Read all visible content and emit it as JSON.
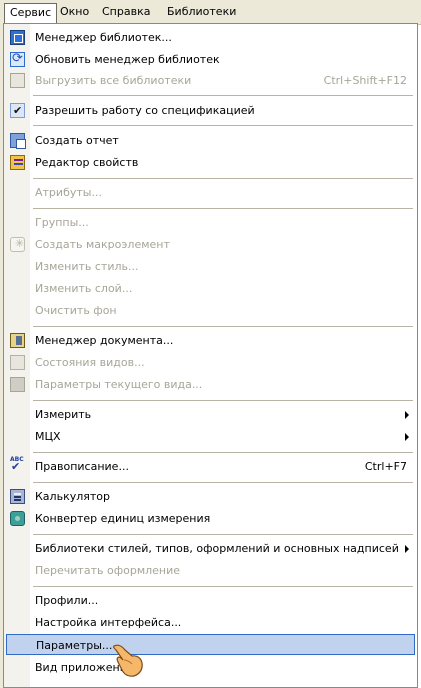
{
  "menubar": {
    "items": [
      "Сервис",
      "Окно",
      "Справка",
      "Библиотеки"
    ]
  },
  "menu": {
    "items": [
      {
        "label": "Менеджер библиотек...",
        "shortcut": "",
        "icon": "library-manager-icon",
        "disabled": false
      },
      {
        "label": "Обновить менеджер библиотек",
        "shortcut": "",
        "icon": "refresh-library-icon",
        "disabled": false
      },
      {
        "label": "Выгрузить все библиотеки",
        "shortcut": "Ctrl+Shift+F12",
        "icon": "unload-libraries-icon",
        "disabled": true
      },
      {
        "label": "Разрешить работу со спецификацией",
        "shortcut": "",
        "icon": "checkmark-icon",
        "disabled": false,
        "checked": true
      },
      {
        "label": "Создать отчет",
        "shortcut": "",
        "icon": "report-icon",
        "disabled": false
      },
      {
        "label": "Редактор свойств",
        "shortcut": "",
        "icon": "properties-editor-icon",
        "disabled": false
      },
      {
        "label": "Атрибуты...",
        "shortcut": "",
        "icon": "",
        "disabled": true
      },
      {
        "label": "Группы...",
        "shortcut": "",
        "icon": "",
        "disabled": true
      },
      {
        "label": "Создать макроэлемент",
        "shortcut": "",
        "icon": "macro-element-icon",
        "disabled": true
      },
      {
        "label": "Изменить стиль...",
        "shortcut": "",
        "icon": "",
        "disabled": true
      },
      {
        "label": "Изменить слой...",
        "shortcut": "",
        "icon": "",
        "disabled": true
      },
      {
        "label": "Очистить фон",
        "shortcut": "",
        "icon": "",
        "disabled": true
      },
      {
        "label": "Менеджер документа...",
        "shortcut": "",
        "icon": "document-manager-icon",
        "disabled": false
      },
      {
        "label": "Состояния видов...",
        "shortcut": "",
        "icon": "view-states-icon",
        "disabled": true
      },
      {
        "label": "Параметры текущего вида...",
        "shortcut": "",
        "icon": "view-parameters-icon",
        "disabled": true
      },
      {
        "label": "Измерить",
        "shortcut": "",
        "icon": "",
        "disabled": false,
        "submenu": true
      },
      {
        "label": "МЦХ",
        "shortcut": "",
        "icon": "",
        "disabled": false,
        "submenu": true
      },
      {
        "label": "Правописание...",
        "shortcut": "Ctrl+F7",
        "icon": "spelling-icon",
        "disabled": false
      },
      {
        "label": "Калькулятор",
        "shortcut": "",
        "icon": "calculator-icon",
        "disabled": false
      },
      {
        "label": "Конвертер единиц измерения",
        "shortcut": "",
        "icon": "unit-converter-icon",
        "disabled": false
      },
      {
        "label": "Библиотеки стилей, типов, оформлений и основных надписей",
        "shortcut": "",
        "icon": "",
        "disabled": false,
        "submenu": true
      },
      {
        "label": "Перечитать оформление",
        "shortcut": "",
        "icon": "",
        "disabled": true
      },
      {
        "label": "Профили...",
        "shortcut": "",
        "icon": "",
        "disabled": false
      },
      {
        "label": "Настройка интерфейса...",
        "shortcut": "",
        "icon": "",
        "disabled": false
      },
      {
        "label": "Параметры...",
        "shortcut": "",
        "icon": "",
        "disabled": false,
        "highlighted": true
      },
      {
        "label": "Вид приложения",
        "shortcut": "",
        "icon": "",
        "disabled": false
      }
    ]
  }
}
